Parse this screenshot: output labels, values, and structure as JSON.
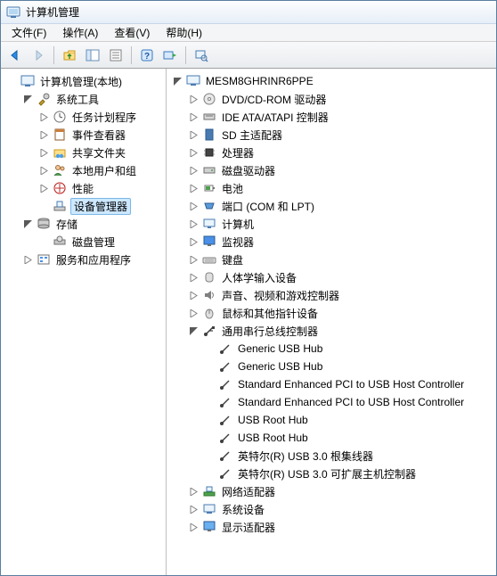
{
  "window": {
    "title": "计算机管理"
  },
  "menu": {
    "file": "文件(F)",
    "action": "操作(A)",
    "view": "查看(V)",
    "help": "帮助(H)"
  },
  "left_tree": {
    "root": "计算机管理(本地)",
    "system_tools": "系统工具",
    "task_scheduler": "任务计划程序",
    "event_viewer": "事件查看器",
    "shared_folders": "共享文件夹",
    "local_users": "本地用户和组",
    "performance": "性能",
    "device_manager": "设备管理器",
    "storage": "存储",
    "disk_mgmt": "磁盘管理",
    "services_apps": "服务和应用程序"
  },
  "right_tree": {
    "computer": "MESM8GHRINR6PPE",
    "dvd": "DVD/CD-ROM 驱动器",
    "ide": "IDE ATA/ATAPI 控制器",
    "sd": "SD 主适配器",
    "processor": "处理器",
    "disk_drives": "磁盘驱动器",
    "battery": "电池",
    "ports": "端口 (COM 和 LPT)",
    "computer_cat": "计算机",
    "monitor": "监视器",
    "keyboard": "键盘",
    "hid": "人体学输入设备",
    "sound": "声音、视频和游戏控制器",
    "mouse": "鼠标和其他指针设备",
    "usb_controllers": "通用串行总线控制器",
    "usb_items": {
      "i0": "Generic USB Hub",
      "i1": "Generic USB Hub",
      "i2": "Standard Enhanced PCI to USB Host Controller",
      "i3": "Standard Enhanced PCI to USB Host Controller",
      "i4": "USB Root Hub",
      "i5": "USB Root Hub",
      "i6": "英特尔(R) USB 3.0 根集线器",
      "i7": "英特尔(R) USB 3.0 可扩展主机控制器"
    },
    "network": "网络适配器",
    "system_devices": "系统设备",
    "display": "显示适配器"
  }
}
